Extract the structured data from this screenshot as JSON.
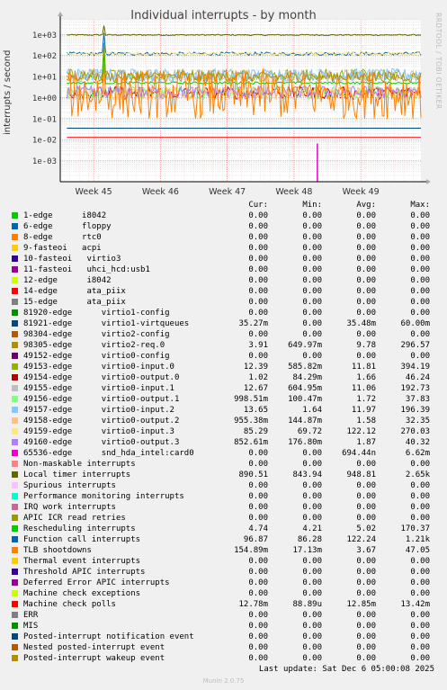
{
  "side_text": "RRDTOOL / TOBI OETIKER",
  "footer": {
    "last_update": "Last update: Sat Dec  6 05:00:08 2025",
    "munin": "Munin 2.0.75"
  },
  "legend_headers": {
    "cur": "Cur:",
    "min": "Min:",
    "avg": "Avg:",
    "max": "Max:"
  },
  "legend": [
    {
      "name": "1-edge      i8042",
      "color": "#00cc00",
      "cur": "0.00",
      "min": "0.00",
      "avg": "0.00",
      "max": "0.00"
    },
    {
      "name": "6-edge      floppy",
      "color": "#0066b3",
      "cur": "0.00",
      "min": "0.00",
      "avg": "0.00",
      "max": "0.00"
    },
    {
      "name": "8-edge      rtc0",
      "color": "#ff8000",
      "cur": "0.00",
      "min": "0.00",
      "avg": "0.00",
      "max": "0.00"
    },
    {
      "name": "9-fasteoi   acpi",
      "color": "#ffcc00",
      "cur": "0.00",
      "min": "0.00",
      "avg": "0.00",
      "max": "0.00"
    },
    {
      "name": "10-fasteoi   virtio3",
      "color": "#330099",
      "cur": "0.00",
      "min": "0.00",
      "avg": "0.00",
      "max": "0.00"
    },
    {
      "name": "11-fasteoi   uhci_hcd:usb1",
      "color": "#990099",
      "cur": "0.00",
      "min": "0.00",
      "avg": "0.00",
      "max": "0.00"
    },
    {
      "name": "12-edge      i8042",
      "color": "#ccff00",
      "cur": "0.00",
      "min": "0.00",
      "avg": "0.00",
      "max": "0.00"
    },
    {
      "name": "14-edge      ata_piix",
      "color": "#ff0000",
      "cur": "0.00",
      "min": "0.00",
      "avg": "0.00",
      "max": "0.00"
    },
    {
      "name": "15-edge      ata_piix",
      "color": "#808080",
      "cur": "0.00",
      "min": "0.00",
      "avg": "0.00",
      "max": "0.00"
    },
    {
      "name": "81920-edge      virtio1-config",
      "color": "#008f00",
      "cur": "0.00",
      "min": "0.00",
      "avg": "0.00",
      "max": "0.00"
    },
    {
      "name": "81921-edge      virtio1-virtqueues",
      "color": "#00487d",
      "cur": "35.27m",
      "min": "0.00",
      "avg": "35.48m",
      "max": "60.00m"
    },
    {
      "name": "98304-edge      virtio2-config",
      "color": "#b35a00",
      "cur": "0.00",
      "min": "0.00",
      "avg": "0.00",
      "max": "0.00"
    },
    {
      "name": "98305-edge      virtio2-req.0",
      "color": "#b38f00",
      "cur": "3.91",
      "min": "649.97m",
      "avg": "9.78",
      "max": "296.57"
    },
    {
      "name": "49152-edge      virtio0-config",
      "color": "#6b006b",
      "cur": "0.00",
      "min": "0.00",
      "avg": "0.00",
      "max": "0.00"
    },
    {
      "name": "49153-edge      virtio0-input.0",
      "color": "#8fb300",
      "cur": "12.39",
      "min": "585.82m",
      "avg": "11.81",
      "max": "394.19"
    },
    {
      "name": "49154-edge      virtio0-output.0",
      "color": "#b30000",
      "cur": "1.02",
      "min": "84.29m",
      "avg": "1.66",
      "max": "46.24"
    },
    {
      "name": "49155-edge      virtio0-input.1",
      "color": "#bebebe",
      "cur": "12.67",
      "min": "604.95m",
      "avg": "11.06",
      "max": "192.73"
    },
    {
      "name": "49156-edge      virtio0-output.1",
      "color": "#80ff80",
      "cur": "998.51m",
      "min": "100.47m",
      "avg": "1.72",
      "max": "37.83"
    },
    {
      "name": "49157-edge      virtio0-input.2",
      "color": "#80c9ff",
      "cur": "13.65",
      "min": "1.64",
      "avg": "11.97",
      "max": "196.39"
    },
    {
      "name": "49158-edge      virtio0-output.2",
      "color": "#ffc080",
      "cur": "955.38m",
      "min": "144.87m",
      "avg": "1.58",
      "max": "32.35"
    },
    {
      "name": "49159-edge      virtio0-input.3",
      "color": "#ffe680",
      "cur": "85.29",
      "min": "69.72",
      "avg": "122.12",
      "max": "270.03"
    },
    {
      "name": "49160-edge      virtio0-output.3",
      "color": "#aa80ff",
      "cur": "852.61m",
      "min": "176.80m",
      "avg": "1.87",
      "max": "40.32"
    },
    {
      "name": "65536-edge      snd_hda_intel:card0",
      "color": "#ee00cc",
      "cur": "0.00",
      "min": "0.00",
      "avg": "694.44n",
      "max": "6.62m"
    },
    {
      "name": "Non-maskable interrupts",
      "color": "#ff8080",
      "cur": "0.00",
      "min": "0.00",
      "avg": "0.00",
      "max": "0.00"
    },
    {
      "name": "Local timer interrupts",
      "color": "#666600",
      "cur": "890.51",
      "min": "843.94",
      "avg": "948.81",
      "max": "2.65k"
    },
    {
      "name": "Spurious interrupts",
      "color": "#ffbfff",
      "cur": "0.00",
      "min": "0.00",
      "avg": "0.00",
      "max": "0.00"
    },
    {
      "name": "Performance monitoring interrupts",
      "color": "#00ffcc",
      "cur": "0.00",
      "min": "0.00",
      "avg": "0.00",
      "max": "0.00"
    },
    {
      "name": "IRQ work interrupts",
      "color": "#cc6699",
      "cur": "0.00",
      "min": "0.00",
      "avg": "0.00",
      "max": "0.00"
    },
    {
      "name": "APIC ICR read retries",
      "color": "#999900",
      "cur": "0.00",
      "min": "0.00",
      "avg": "0.00",
      "max": "0.00"
    },
    {
      "name": "Rescheduling interrupts",
      "color": "#00cc00",
      "cur": "4.74",
      "min": "4.21",
      "avg": "5.02",
      "max": "170.37"
    },
    {
      "name": "Function call interrupts",
      "color": "#0066b3",
      "cur": "96.87",
      "min": "86.28",
      "avg": "122.24",
      "max": "1.21k"
    },
    {
      "name": "TLB shootdowns",
      "color": "#ff8000",
      "cur": "154.89m",
      "min": "17.13m",
      "avg": "3.67",
      "max": "47.05"
    },
    {
      "name": "Thermal event interrupts",
      "color": "#ffcc00",
      "cur": "0.00",
      "min": "0.00",
      "avg": "0.00",
      "max": "0.00"
    },
    {
      "name": "Threshold APIC interrupts",
      "color": "#330099",
      "cur": "0.00",
      "min": "0.00",
      "avg": "0.00",
      "max": "0.00"
    },
    {
      "name": "Deferred Error APIC interrupts",
      "color": "#990099",
      "cur": "0.00",
      "min": "0.00",
      "avg": "0.00",
      "max": "0.00"
    },
    {
      "name": "Machine check exceptions",
      "color": "#ccff00",
      "cur": "0.00",
      "min": "0.00",
      "avg": "0.00",
      "max": "0.00"
    },
    {
      "name": "Machine check polls",
      "color": "#ff0000",
      "cur": "12.78m",
      "min": "88.89u",
      "avg": "12.85m",
      "max": "13.42m"
    },
    {
      "name": "ERR",
      "color": "#808080",
      "cur": "0.00",
      "min": "0.00",
      "avg": "0.00",
      "max": "0.00"
    },
    {
      "name": "MIS",
      "color": "#008f00",
      "cur": "0.00",
      "min": "0.00",
      "avg": "0.00",
      "max": "0.00"
    },
    {
      "name": "Posted-interrupt notification event",
      "color": "#00487d",
      "cur": "0.00",
      "min": "0.00",
      "avg": "0.00",
      "max": "0.00"
    },
    {
      "name": "Nested posted-interrupt event",
      "color": "#b35a00",
      "cur": "0.00",
      "min": "0.00",
      "avg": "0.00",
      "max": "0.00"
    },
    {
      "name": "Posted-interrupt wakeup event",
      "color": "#b38f00",
      "cur": "0.00",
      "min": "0.00",
      "avg": "0.00",
      "max": "0.00"
    }
  ],
  "chart_data": {
    "type": "line",
    "title": "Individual interrupts - by month",
    "ylabel": "interrupts / second",
    "yscale": "log",
    "ylim": [
      0.0001,
      5000
    ],
    "ytick_labels": [
      "1e+03",
      "1e+02",
      "1e+01",
      "1e+00",
      "1e-01",
      "1e-02",
      "1e-03"
    ],
    "x_range_weeks": [
      44.5,
      49.9
    ],
    "xtick_labels": [
      "Week 45",
      "Week 46",
      "Week 47",
      "Week 48",
      "Week 49"
    ],
    "xtick_weeks": [
      45,
      46,
      47,
      48,
      49
    ],
    "grid": true,
    "series": [
      {
        "name": "Local timer interrupts",
        "color": "#666600",
        "typical": 950,
        "jitter": 0.03,
        "spikes": [
          [
            45.15,
            2650
          ]
        ]
      },
      {
        "name": "Function call interrupts",
        "color": "#0066b3",
        "typical": 122,
        "jitter": 0.08,
        "spikes": [
          [
            45.15,
            1210
          ]
        ]
      },
      {
        "name": "49159-edge      virtio0-input.3",
        "color": "#ffe680",
        "typical": 120,
        "jitter": 0.08,
        "spikes": []
      },
      {
        "name": "49153-edge      virtio0-input.0",
        "color": "#8fb300",
        "typical": 11.8,
        "jitter": 0.3,
        "spikes": [
          [
            45.15,
            394
          ]
        ]
      },
      {
        "name": "49155-edge      virtio0-input.1",
        "color": "#bebebe",
        "typical": 11,
        "jitter": 0.3,
        "spikes": []
      },
      {
        "name": "49157-edge      virtio0-input.2",
        "color": "#80c9ff",
        "typical": 12,
        "jitter": 0.3,
        "spikes": []
      },
      {
        "name": "98305-edge      virtio2-req.0",
        "color": "#b38f00",
        "typical": 9.8,
        "jitter": 0.25,
        "spikes": [
          [
            45.15,
            296
          ]
        ]
      },
      {
        "name": "Rescheduling interrupts",
        "color": "#00cc00",
        "typical": 5,
        "jitter": 0.05,
        "spikes": [
          [
            45.15,
            170
          ]
        ]
      },
      {
        "name": "49154-edge      virtio0-output.0",
        "color": "#b30000",
        "typical": 1.66,
        "jitter": 0.3,
        "spikes": []
      },
      {
        "name": "49156-edge      virtio0-output.1",
        "color": "#80ff80",
        "typical": 1.7,
        "jitter": 0.3,
        "spikes": []
      },
      {
        "name": "49158-edge      virtio0-output.2",
        "color": "#ffc080",
        "typical": 1.6,
        "jitter": 0.3,
        "spikes": []
      },
      {
        "name": "49160-edge      virtio0-output.3",
        "color": "#aa80ff",
        "typical": 1.8,
        "jitter": 0.3,
        "spikes": []
      },
      {
        "name": "TLB shootdowns",
        "color": "#ff8000",
        "typical": 1.5,
        "jitter": 1.2,
        "spikes": [
          [
            45.15,
            47
          ]
        ]
      },
      {
        "name": "81921-edge      virtio1-virtqueues",
        "color": "#00487d",
        "typical": 0.035,
        "jitter": 0.0,
        "spikes": []
      },
      {
        "name": "Machine check polls",
        "color": "#ff0000",
        "typical": 0.0128,
        "jitter": 0.0,
        "spikes": []
      },
      {
        "name": "65536-edge      snd_hda_intel:card0",
        "color": "#ee00cc",
        "typical": 0,
        "jitter": 0.0,
        "spikes": [
          [
            48.35,
            0.0066
          ]
        ]
      }
    ]
  }
}
